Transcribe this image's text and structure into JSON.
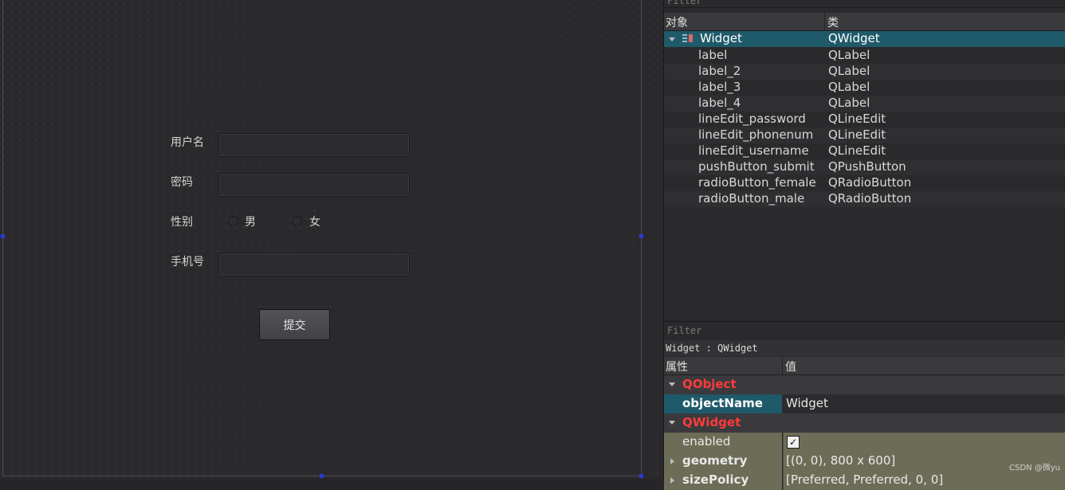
{
  "canvas": {
    "form": {
      "username_label": "用户名",
      "password_label": "密码",
      "gender_label": "性别",
      "male_label": "男",
      "female_label": "女",
      "phone_label": "手机号",
      "submit_label": "提交"
    }
  },
  "object_inspector": {
    "filter_label": "Filter",
    "header": {
      "object": "对象",
      "class": "类"
    },
    "root": {
      "name": "Widget",
      "class": "QWidget"
    },
    "children": [
      {
        "name": "label",
        "class": "QLabel"
      },
      {
        "name": "label_2",
        "class": "QLabel"
      },
      {
        "name": "label_3",
        "class": "QLabel"
      },
      {
        "name": "label_4",
        "class": "QLabel"
      },
      {
        "name": "lineEdit_password",
        "class": "QLineEdit"
      },
      {
        "name": "lineEdit_phonenum",
        "class": "QLineEdit"
      },
      {
        "name": "lineEdit_username",
        "class": "QLineEdit"
      },
      {
        "name": "pushButton_submit",
        "class": "QPushButton"
      },
      {
        "name": "radioButton_female",
        "class": "QRadioButton"
      },
      {
        "name": "radioButton_male",
        "class": "QRadioButton"
      }
    ]
  },
  "property_editor": {
    "filter_label": "Filter",
    "context": "Widget : QWidget",
    "header": {
      "property": "属性",
      "value": "值"
    },
    "qobject_category": "QObject",
    "objectname_name": "objectName",
    "objectname_value": "Widget",
    "qwidget_category": "QWidget",
    "enabled_name": "enabled",
    "enabled_check": "✓",
    "geometry_name": "geometry",
    "geometry_value": "[(0, 0), 800 x 600]",
    "sizepolicy_name": "sizePolicy",
    "sizepolicy_value": "[Preferred, Preferred, 0, 0]"
  },
  "watermark": "CSDN @微yu",
  "colors": {
    "selection": "#1f5a6a",
    "category_text": "#ff3b3b",
    "olive_row": "#6d6d57",
    "handle": "#2a39d8"
  }
}
